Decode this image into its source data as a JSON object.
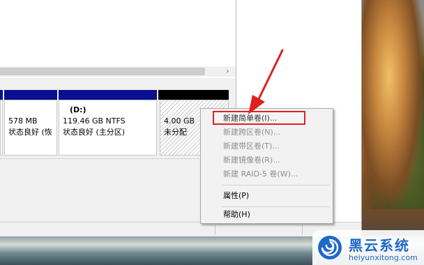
{
  "partitions": [
    {
      "title": "",
      "size": "578 MB",
      "status": "状态良好 (恢"
    },
    {
      "title": "(D:)",
      "size": "119.46 GB NTFS",
      "status": "状态良好 (主分区)"
    },
    {
      "title": "",
      "size": "4.00 GB",
      "status": "未分配"
    }
  ],
  "context_menu": {
    "items": [
      {
        "label": "新建简单卷(I)...",
        "enabled": true,
        "highlighted": true
      },
      {
        "label": "新建跨区卷(N)...",
        "enabled": false
      },
      {
        "label": "新建带区卷(T)...",
        "enabled": false
      },
      {
        "label": "新建镜像卷(R)...",
        "enabled": false
      },
      {
        "label": "新建 RAID-5 卷(W)...",
        "enabled": false
      },
      {
        "label": "属性(P)",
        "enabled": true
      },
      {
        "label": "帮助(H)",
        "enabled": true
      }
    ]
  },
  "scrollbar": {
    "right_arrow": "›"
  },
  "watermark": {
    "name": "黑云系统",
    "url": "heiyunxitong.com"
  },
  "colors": {
    "partition_bar": "#0a0f8f",
    "unallocated_bar": "#000000",
    "annotation": "#e02020",
    "brand": "#1f69c8"
  },
  "icons": [
    "chevron-right-icon",
    "red-arrow-annotation",
    "heiyun-logo-icon"
  ]
}
